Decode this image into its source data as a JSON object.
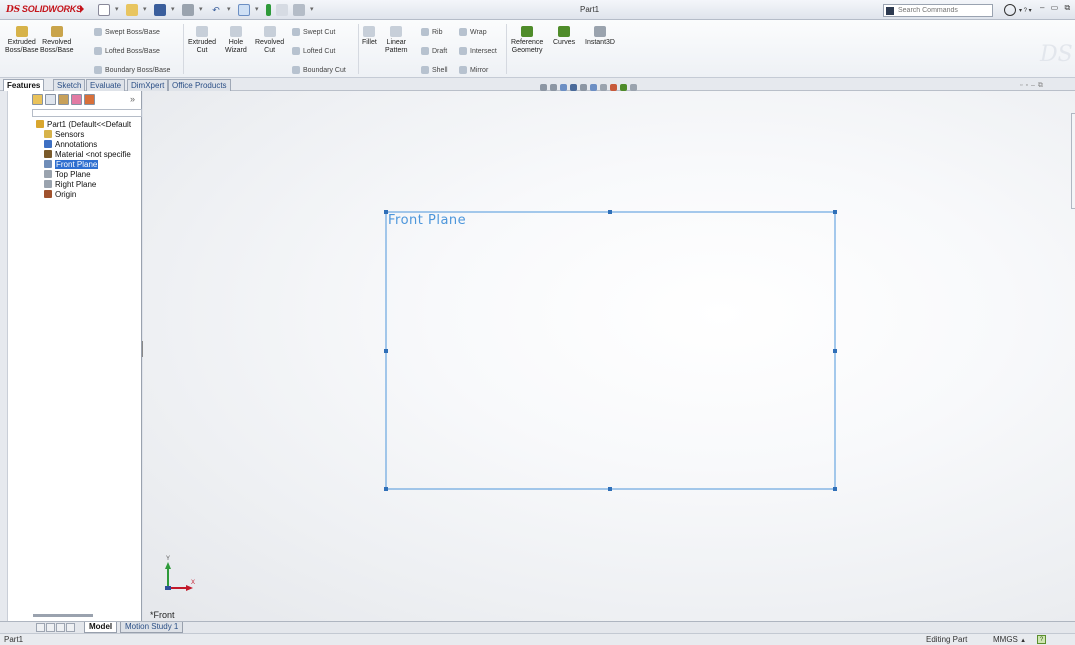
{
  "app": {
    "logo_text": "SOLIDWORKS",
    "logo_mark": "DS",
    "document_title": "Part1",
    "search_placeholder": "Search Commands"
  },
  "quick_access": {
    "icons": [
      "new-icon",
      "open-icon",
      "save-icon",
      "print-icon",
      "undo-icon",
      "select-icon",
      "rebuild-icon",
      "file-properties-icon",
      "options-icon"
    ]
  },
  "command_manager": {
    "big_buttons": [
      {
        "label_line1": "Extruded",
        "label_line2": "Boss/Base",
        "color": "#d7b34a"
      },
      {
        "label_line1": "Revolved",
        "label_line2": "Boss/Base",
        "color": "#c9a44b"
      },
      {
        "label_line1": "Extruded",
        "label_line2": "Cut",
        "color": "#c7cfd9"
      },
      {
        "label_line1": "Hole",
        "label_line2": "Wizard",
        "color": "#c7cfd9"
      },
      {
        "label_line1": "Revolved",
        "label_line2": "Cut",
        "color": "#c7cfd9"
      }
    ],
    "boss_small": [
      "Swept Boss/Base",
      "Lofted Boss/Base",
      "Boundary Boss/Base"
    ],
    "cut_small": [
      "Swept Cut",
      "Lofted Cut",
      "Boundary Cut"
    ],
    "fillet_label": "Fillet",
    "linear_pattern": {
      "line1": "Linear",
      "line2": "Pattern"
    },
    "feature_small": [
      "Rib",
      "Draft",
      "Shell",
      "Wrap",
      "Intersect",
      "Mirror"
    ],
    "reference_geometry": {
      "line1": "Reference",
      "line2": "Geometry",
      "color": "#4f8c2a"
    },
    "curves_label": "Curves",
    "instant3d_label": "Instant3D"
  },
  "tabs": [
    "Features",
    "Sketch",
    "Evaluate",
    "DimXpert",
    "Office Products"
  ],
  "active_tab": "Features",
  "feature_tree": {
    "items": [
      {
        "label": "Part1  (Default<<Default",
        "icon_color": "#d9a62e",
        "indent": 0
      },
      {
        "label": "Sensors",
        "icon_color": "#d7b34a",
        "indent": 1
      },
      {
        "label": "Annotations",
        "icon_color": "#3d6fc2",
        "indent": 1
      },
      {
        "label": "Material <not specifie",
        "icon_color": "#7a5a2a",
        "indent": 1
      },
      {
        "label": "Front Plane",
        "icon_color": "#6f8db8",
        "indent": 1
      },
      {
        "label": "Top Plane",
        "icon_color": "#9aa3ae",
        "indent": 1
      },
      {
        "label": "Right Plane",
        "icon_color": "#9aa3ae",
        "indent": 1
      },
      {
        "label": "Origin",
        "icon_color": "#a0522d",
        "indent": 1
      }
    ],
    "selected_index": 4
  },
  "viewport": {
    "plane_label": "Front Plane",
    "plane_color": "#4d96db",
    "view_name": "*Front",
    "triad_x": "X",
    "triad_y": "Y"
  },
  "bottom_tabs": [
    "Model",
    "Motion Study 1"
  ],
  "status_bar": {
    "left": "Part1",
    "mode": "Editing Part",
    "units": "MMGS",
    "units_arrow": "▲",
    "help": "?"
  }
}
